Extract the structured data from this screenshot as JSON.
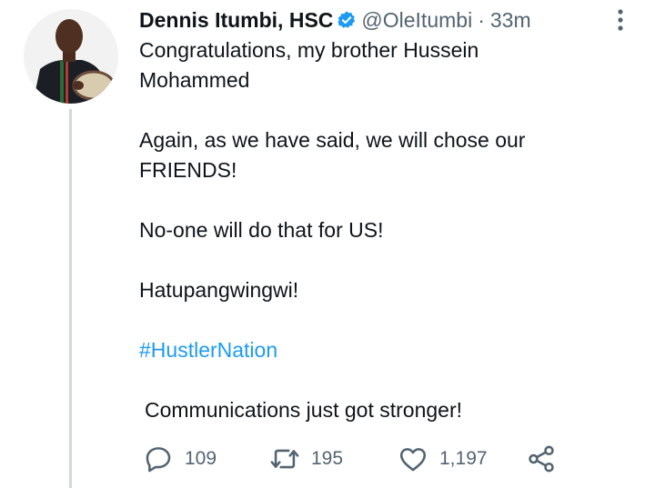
{
  "tweet": {
    "author_name": "Dennis Itumbi, HSC",
    "handle": "@OleItumbi",
    "separator": "·",
    "time": "33m",
    "lines": [
      "Congratulations, my brother Hussein",
      "Mohammed",
      "Again, as we have said, we will chose our",
      "FRIENDS!",
      "No-one will do that for US!",
      "Hatupangwingwi!"
    ],
    "hashtag": "#HustlerNation",
    "footer_line": "Communications  just got stronger!"
  },
  "actions": {
    "reply_count": "109",
    "retweet_count": "195",
    "like_count": "1,197"
  },
  "icons": {
    "verified": "verified-badge-icon",
    "more": "more-vertical-icon",
    "reply": "reply-icon",
    "retweet": "retweet-icon",
    "like": "heart-icon",
    "share": "share-icon"
  },
  "colors": {
    "text": "#0f1419",
    "secondary": "#536471",
    "accent": "#1d9bf0",
    "thread_line": "#cfd9de"
  }
}
